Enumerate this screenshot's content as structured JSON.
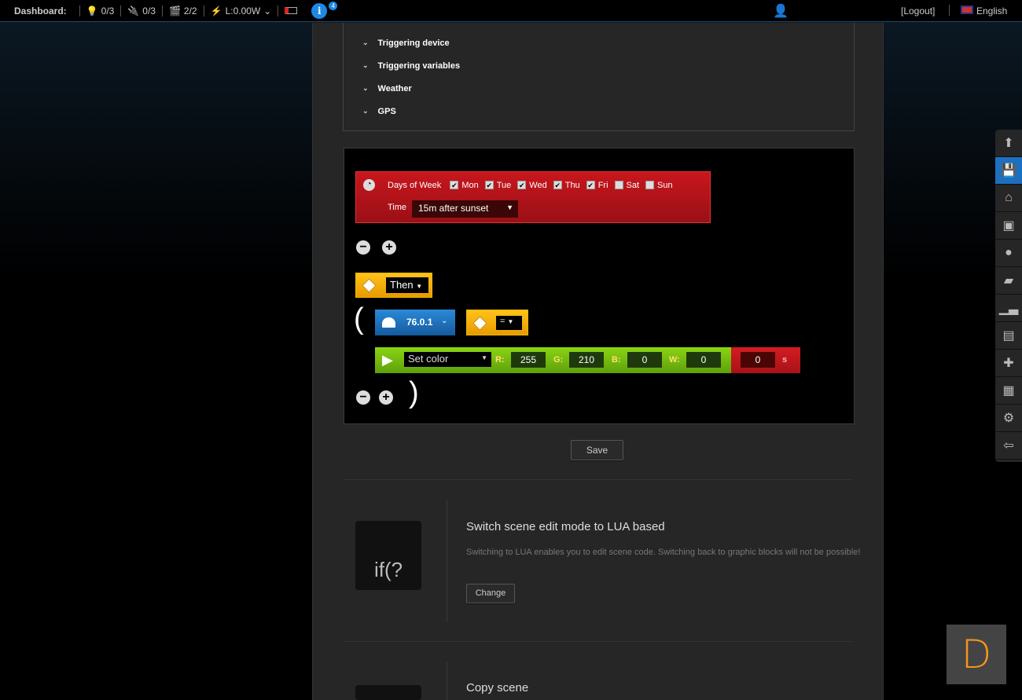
{
  "topbar": {
    "title": "Dashboard:",
    "lights": "0/3",
    "plugs": "0/3",
    "scenes": "2/2",
    "power": "L:0.00W",
    "info_badge": "4",
    "logout": "[Logout]",
    "language": "English"
  },
  "triggers": [
    "Triggering device",
    "Triggering variables",
    "Weather",
    "GPS"
  ],
  "condition": {
    "days_label": "Days of Week",
    "days": [
      {
        "d": "Mon",
        "on": true
      },
      {
        "d": "Tue",
        "on": true
      },
      {
        "d": "Wed",
        "on": true
      },
      {
        "d": "Thu",
        "on": true
      },
      {
        "d": "Fri",
        "on": true
      },
      {
        "d": "Sat",
        "on": false
      },
      {
        "d": "Sun",
        "on": false
      }
    ],
    "time_label": "Time",
    "time_value": "15m after sunset"
  },
  "then_label": "Then",
  "open_paren": "(",
  "close_paren": ")",
  "device": "76.0.1",
  "operator": "=",
  "action": {
    "select": "Set color",
    "r_label": "R:",
    "r": "255",
    "g_label": "G:",
    "g": "210",
    "b_label": "B:",
    "b": "0",
    "w_label": "W:",
    "w": "0",
    "delay": "0",
    "delay_unit": "s"
  },
  "save_label": "Save",
  "lua": {
    "title": "Switch scene edit mode to LUA based",
    "desc": "Switching to LUA enables you to edit scene code. Switching back to graphic blocks will not be possible!",
    "button": "Change",
    "icon_text": "if(?"
  },
  "copy": {
    "title": "Copy scene"
  },
  "logo": "D",
  "colors": {
    "accent": "#1e88e5",
    "red": "#c8161d",
    "yellow": "#ffc21a",
    "green": "#7cc40a",
    "blue": "#1d6fbf"
  }
}
